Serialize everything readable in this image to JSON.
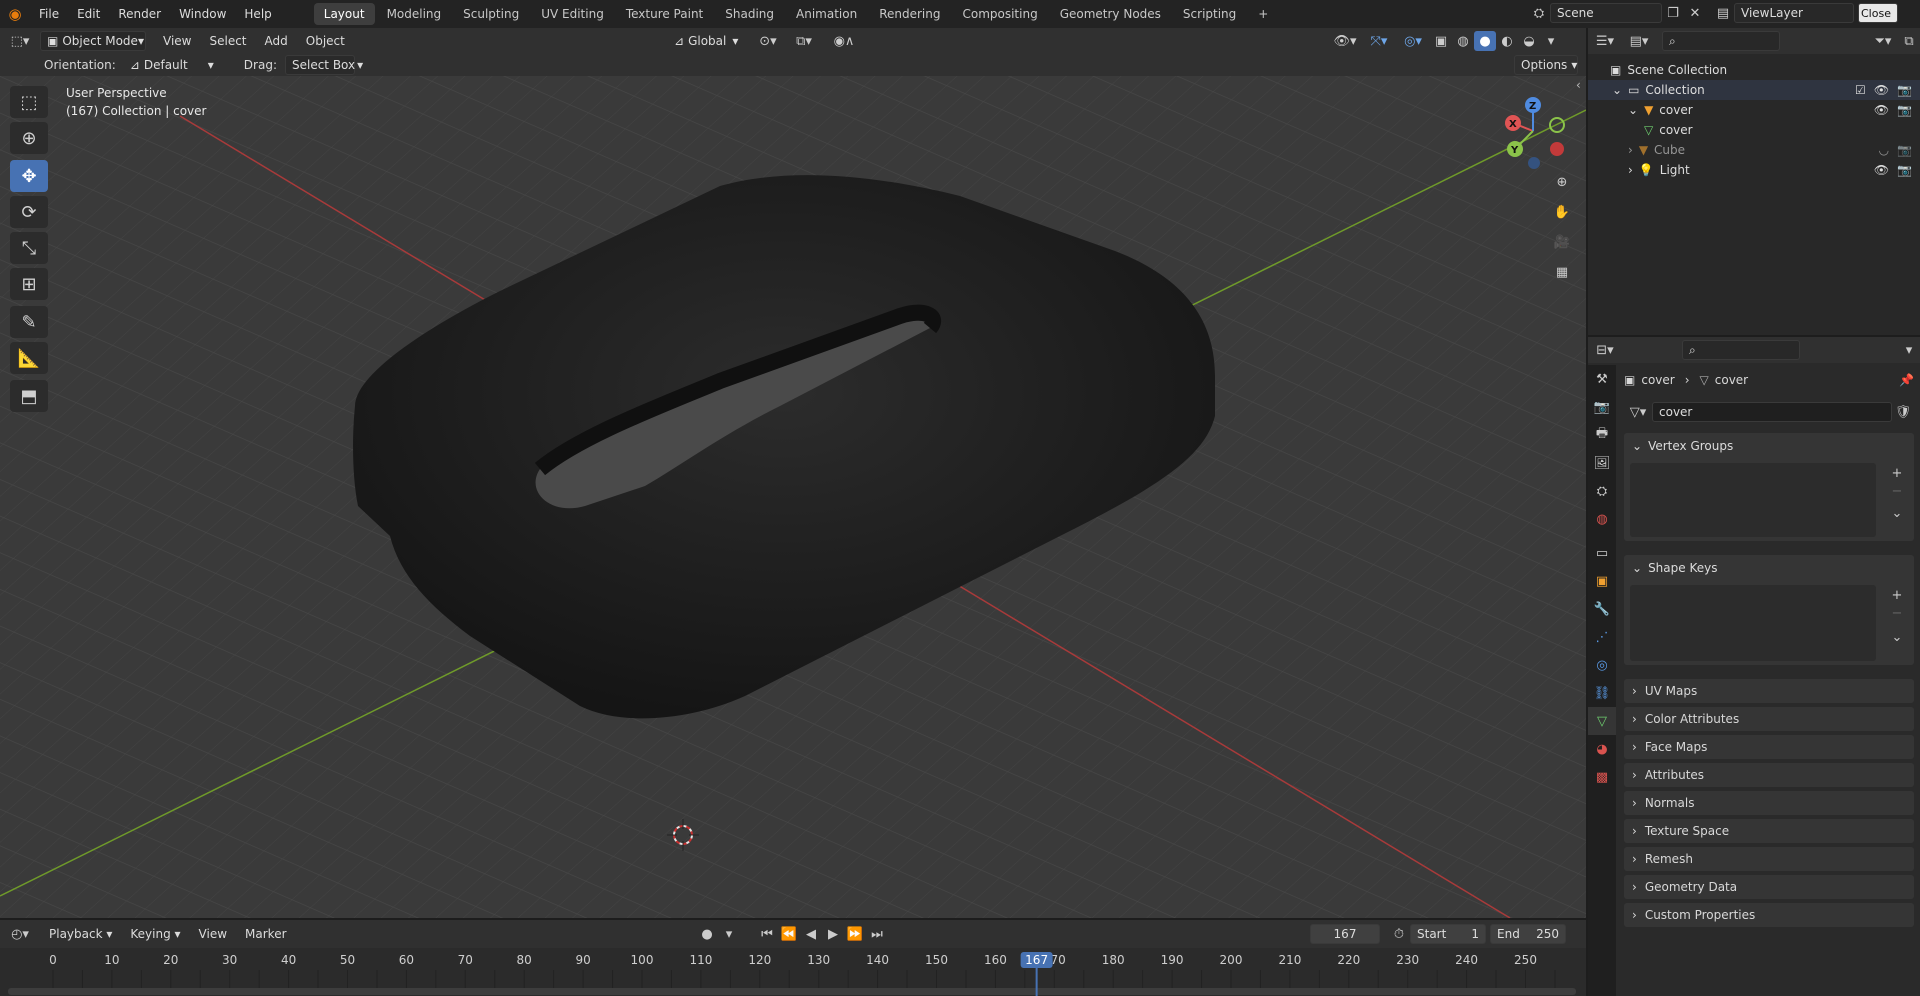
{
  "menu": {
    "items": [
      "File",
      "Edit",
      "Render",
      "Window",
      "Help"
    ],
    "workspaces": [
      "Layout",
      "Modeling",
      "Sculpting",
      "UV Editing",
      "Texture Paint",
      "Shading",
      "Animation",
      "Rendering",
      "Compositing",
      "Geometry Nodes",
      "Scripting"
    ],
    "active_workspace": "Layout",
    "add_tab": "+",
    "scene": "Scene",
    "view_layer": "ViewLayer",
    "close": "Close"
  },
  "viewport_header": {
    "mode": "Object Mode",
    "menus": [
      "View",
      "Select",
      "Add",
      "Object"
    ],
    "transform": "Global",
    "orientation_label": "Orientation:",
    "orientation_value": "Default",
    "drag_label": "Drag:",
    "drag_value": "Select Box",
    "options": "Options"
  },
  "viewport": {
    "perspective": "User Perspective",
    "context": "(167) Collection | cover",
    "gizmo": {
      "x": "X",
      "y": "Y",
      "z": "Z"
    }
  },
  "outliner": {
    "root": "Scene Collection",
    "rows": [
      {
        "label": "Collection",
        "indent": 1,
        "icon": "collection-icon"
      },
      {
        "label": "cover",
        "indent": 2,
        "icon": "mesh-object-icon"
      },
      {
        "label": "cover",
        "indent": 3,
        "icon": "mesh-data-icon"
      },
      {
        "label": "Cube",
        "indent": 2,
        "icon": "mesh-object-icon",
        "dim": true
      },
      {
        "label": "Light",
        "indent": 2,
        "icon": "light-icon"
      }
    ]
  },
  "properties": {
    "breadcrumb_object": "cover",
    "breadcrumb_data": "cover",
    "datablock_name": "cover",
    "panels_open": [
      "Vertex Groups",
      "Shape Keys"
    ],
    "panels_closed": [
      "UV Maps",
      "Color Attributes",
      "Face Maps",
      "Attributes",
      "Normals",
      "Texture Space",
      "Remesh",
      "Geometry Data",
      "Custom Properties"
    ]
  },
  "timeline": {
    "menus": [
      "Playback",
      "Keying",
      "View",
      "Marker"
    ],
    "current_frame": "167",
    "start_label": "Start",
    "start": "1",
    "end_label": "End",
    "end": "250",
    "ticks": [
      "0",
      "10",
      "20",
      "30",
      "40",
      "50",
      "60",
      "70",
      "80",
      "90",
      "100",
      "110",
      "120",
      "130",
      "140",
      "150",
      "160",
      "170",
      "180",
      "190",
      "200",
      "210",
      "220",
      "230",
      "240",
      "250"
    ],
    "playhead": "167"
  }
}
